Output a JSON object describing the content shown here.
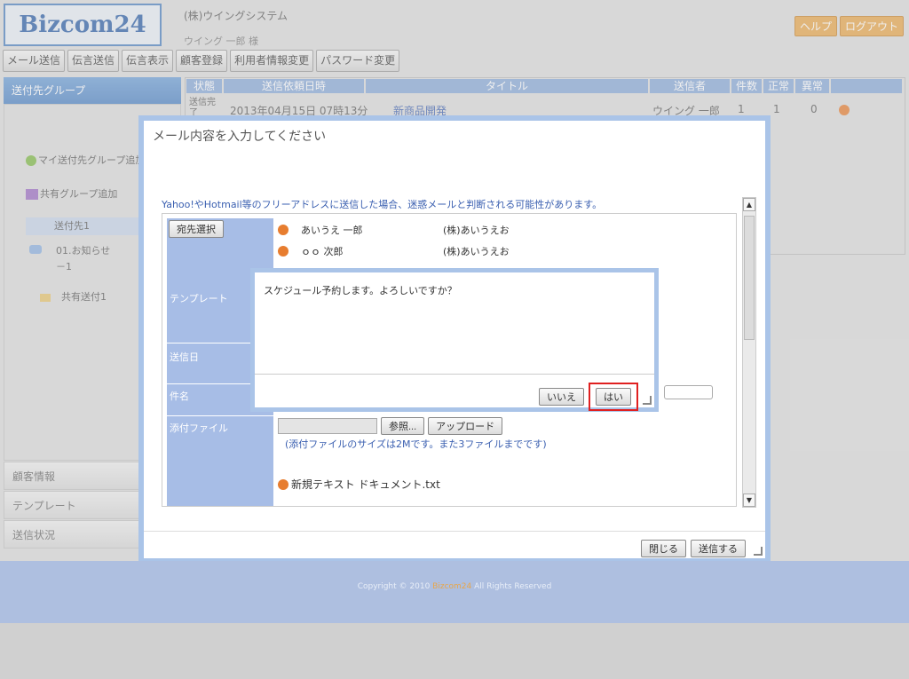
{
  "header": {
    "logo": "Bizcom24",
    "company": "(株)ウイングシステム",
    "user": "ウイング 一郎 様",
    "help_label": "ヘルプ",
    "logout_label": "ログアウト"
  },
  "nav": {
    "items": [
      "メール送信",
      "伝言送信",
      "伝言表示",
      "顧客登録",
      "利用者情報変更",
      "パスワード変更"
    ]
  },
  "sidebar": {
    "group_header": "送付先グループ",
    "add_my_group": "マイ送付先グループ追加",
    "add_shared_group": "共有グループ追加",
    "group1": "送付先1",
    "group2_line1": "01.お知らせ",
    "group2_line2": "－1",
    "shared1": "共有送付1",
    "acc_customer": "顧客情報",
    "acc_template": "テンプレート",
    "acc_status": "送信状況"
  },
  "list": {
    "headers": [
      "状態",
      "送信依頼日時",
      "タイトル",
      "送信者",
      "件数",
      "正常",
      "異常"
    ],
    "row": {
      "status": "送信完了",
      "datetime": "2013年04月15日 07時13分",
      "title": "新商品開発",
      "sender": "ウイング 一郎",
      "count": "1",
      "ok": "1",
      "error": "0"
    }
  },
  "modal": {
    "title": "メール内容を入力してください",
    "warning": "Yahoo!やHotmail等のフリーアドレスに送信した場合、迷惑メールと判断される可能性があります。",
    "select_recipient": "宛先選択",
    "recipients": [
      {
        "name": "あいうえ 一郎",
        "company": "(株)あいうえお"
      },
      {
        "name": "ｏｏ 次郎",
        "company": "(株)あいうえお"
      }
    ],
    "label_template": "テンプレート",
    "label_send_date": "送信日",
    "label_subject": "件名",
    "label_attach": "添付ファイル",
    "browse_label": "参照...",
    "upload_label": "アップロード",
    "attach_note": "(添付ファイルのサイズは2Mです。また3ファイルまでです)",
    "attached_file": "新規テキスト ドキュメント.txt",
    "close_label": "閉じる",
    "send_label": "送信する"
  },
  "confirm": {
    "message": "スケジュール予約します。よろしいですか？",
    "no_label": "いいえ",
    "yes_label": "はい"
  },
  "footer": {
    "copyright_prefix": "Copyright © 2010",
    "brand": "Bizcom24",
    "copyright_suffix": "All Rights Reserved"
  },
  "colors": {
    "accent_blue": "#4d83c5",
    "header_orange": "#e8a64a",
    "highlight_red": "#e02020"
  }
}
